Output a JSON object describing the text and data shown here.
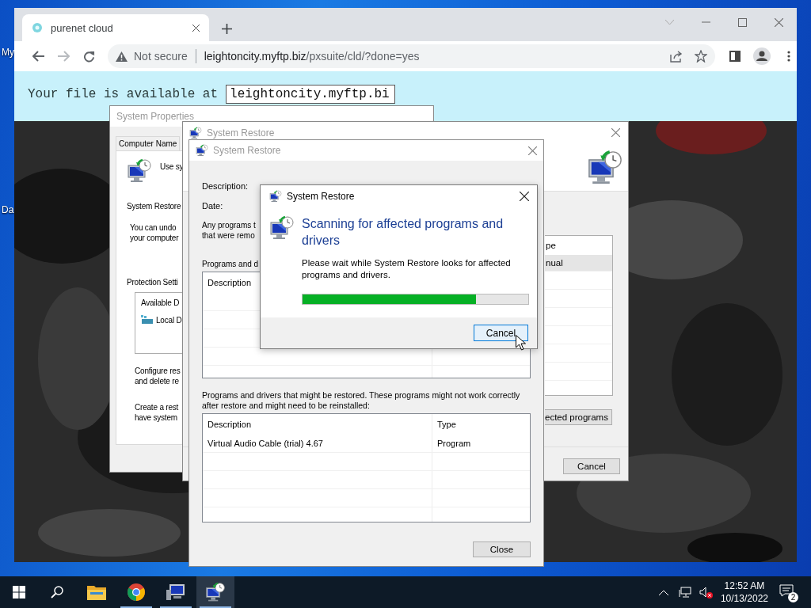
{
  "desktop": {
    "icon_labels": [
      {
        "text": "My"
      },
      {
        "text": "Da"
      }
    ]
  },
  "browser": {
    "tabs": [
      {
        "title": "purenet cloud",
        "selected": true
      }
    ],
    "forward": {
      "disabled": true
    },
    "address": {
      "security": "Not secure",
      "host": "leightoncity.myftp.biz",
      "path": "/pxsuite/cld/?done=yes"
    },
    "page": {
      "message": "Your file is available at",
      "link_field": {
        "value": "leightoncity.myftp.bi"
      }
    }
  },
  "system_properties": {
    "title": "System Properties",
    "tabs": [
      {
        "label": "Computer Name",
        "selected": false
      }
    ],
    "intro": "Use sy",
    "section": "System Restore",
    "restore_text": [
      "You can undo",
      "your computer"
    ],
    "protection_label": "Protection Setti",
    "drives_header": "Available D",
    "drives": [
      "Local D"
    ],
    "configure_text": [
      "Configure res",
      "and delete re"
    ],
    "create_text": [
      "Create a rest",
      "have system"
    ]
  },
  "restore_window": {
    "title": "System Restore",
    "list": {
      "header": "pe",
      "rows": [
        {
          "text": "nual",
          "selected": true
        }
      ]
    },
    "scan_button": "ected programs",
    "cancel_button": "Cancel"
  },
  "restore_details": {
    "title": "System Restore",
    "description_label": "Description:",
    "date_label": "Date:",
    "note": [
      "Any programs t",
      "that were remo"
    ],
    "deleted_label": "Programs and d",
    "deleted_table": {
      "columns": [
        "Description"
      ]
    },
    "restored_text": "Programs and drivers that might be restored. These programs might not work correctly after restore and might need to be reinstalled:",
    "restored_table": {
      "columns": [
        "Description",
        "Type"
      ],
      "rows": [
        [
          "Virtual Audio Cable (trial) 4.67",
          "Program"
        ]
      ]
    },
    "close_button": "Close"
  },
  "scan_dialog": {
    "title": "System Restore",
    "heading": "Scanning for affected programs and drivers",
    "message": "Please wait while System Restore looks for affected programs and drivers.",
    "progress": {
      "level": 0.77
    },
    "buttons": [
      {
        "label": "Cancel",
        "focused": true
      }
    ]
  },
  "taskbar": {
    "apps": [
      {
        "kind": "file-explorer",
        "running": false,
        "selected": false
      },
      {
        "kind": "browser",
        "running": true,
        "selected": false
      },
      {
        "kind": "system-properties",
        "running": true,
        "selected": false
      },
      {
        "kind": "system-restore",
        "running": true,
        "selected": true
      }
    ],
    "clock": {
      "time": "12:52 AM",
      "date": "10/13/2022"
    },
    "notifications": "2"
  }
}
